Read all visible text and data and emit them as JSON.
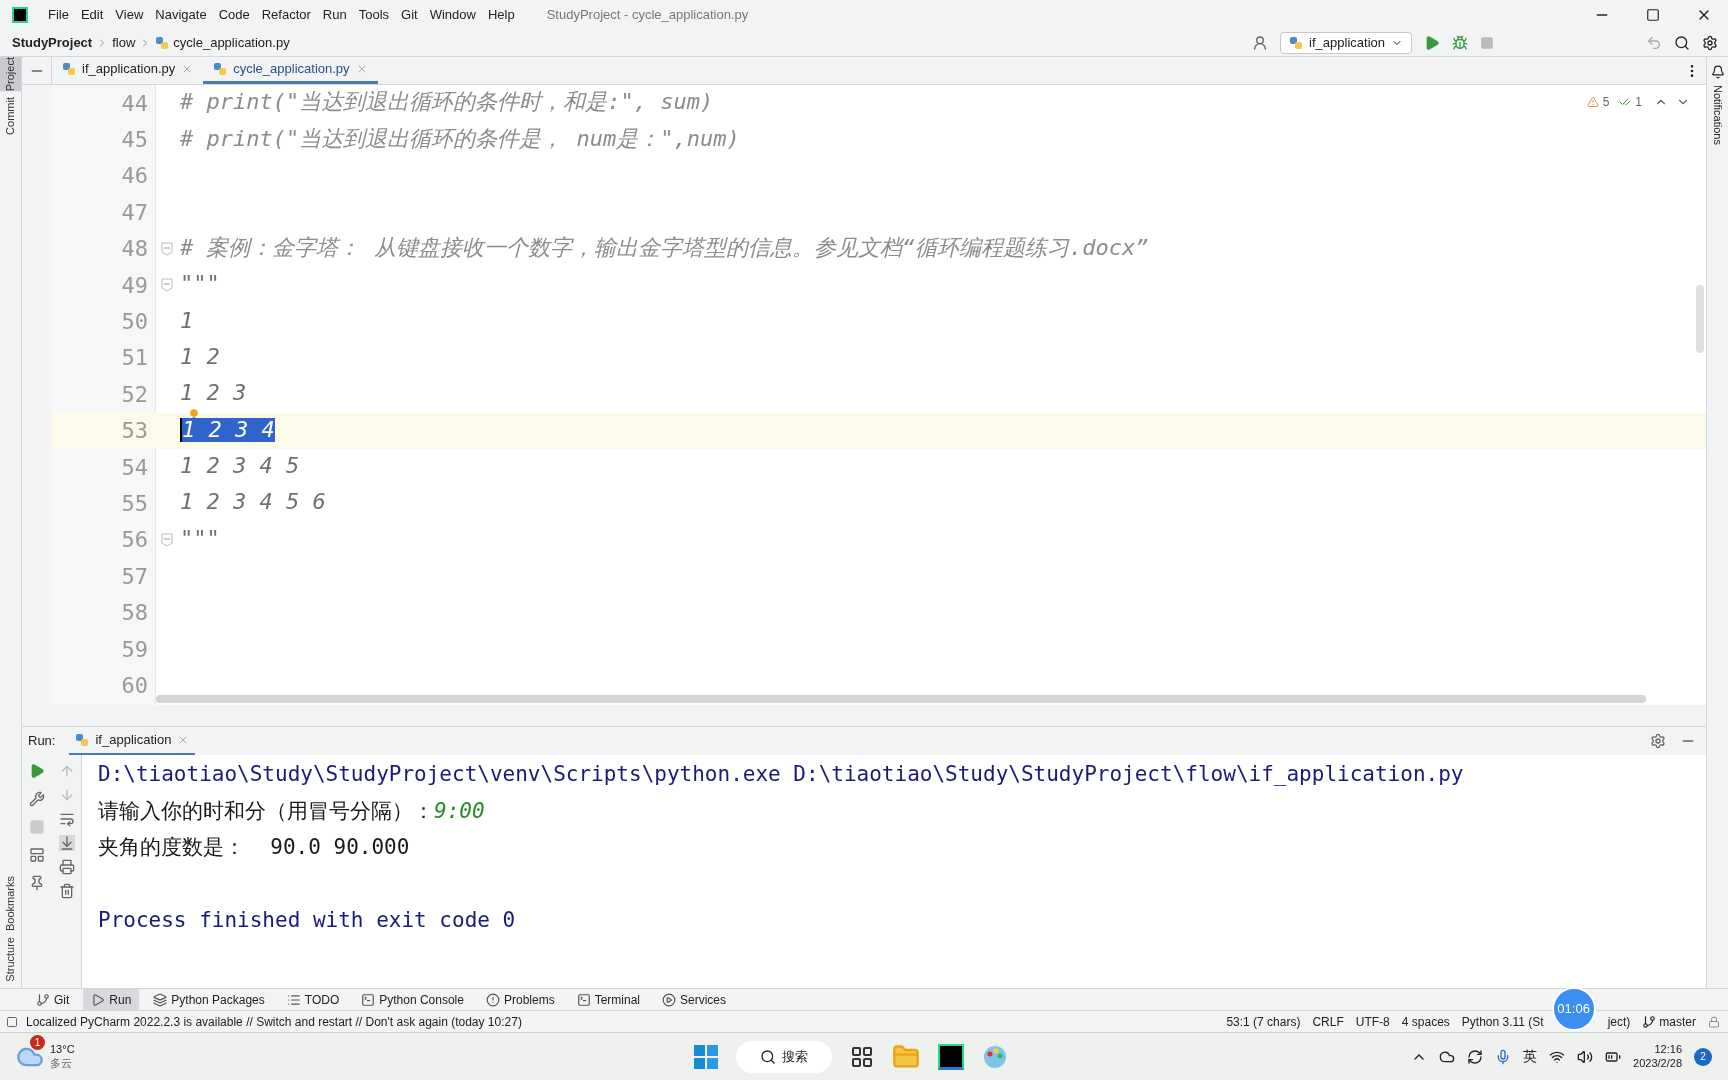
{
  "window": {
    "title": "StudyProject - cycle_application.py",
    "menu": [
      "File",
      "Edit",
      "View",
      "Navigate",
      "Code",
      "Refactor",
      "Run",
      "Tools",
      "Git",
      "Window",
      "Help"
    ]
  },
  "breadcrumb": [
    "StudyProject",
    "flow",
    "cycle_application.py"
  ],
  "run_config": "if_application",
  "side_tools_top": [
    {
      "label": "Project",
      "selected": true
    },
    {
      "label": "Commit",
      "selected": false
    }
  ],
  "side_tools_bottom": [
    {
      "label": "Bookmarks",
      "selected": false
    },
    {
      "label": "Structure",
      "selected": false
    }
  ],
  "right_tools": [
    "Notifications"
  ],
  "tabs": [
    {
      "label": "if_application.py",
      "selected": false
    },
    {
      "label": "cycle_application.py",
      "selected": true
    }
  ],
  "inspections": {
    "warnings": "5",
    "passed": "1"
  },
  "lines": [
    {
      "number": "44",
      "text": "# print(\"当达到退出循环的条件时，和是:\", sum)",
      "kind": "comment",
      "current": false
    },
    {
      "number": "45",
      "text": "# print(\"当达到退出循环的条件是， num是：\",num)",
      "kind": "comment",
      "current": false
    },
    {
      "number": "46",
      "kind": "plain",
      "current": false
    },
    {
      "number": "47",
      "kind": "plain",
      "current": false
    },
    {
      "number": "48",
      "text": "# 案例：金字塔： 从键盘接收一个数字，输出金字塔型的信息。参见文档“循环编程题练习.docx”",
      "kind": "comment",
      "current": false,
      "fold": true
    },
    {
      "number": "49",
      "text": "\"\"\"",
      "kind": "docstring",
      "current": false,
      "fold": true
    },
    {
      "number": "50",
      "text": "1",
      "kind": "docstring",
      "current": false
    },
    {
      "number": "51",
      "text": "1 2",
      "kind": "docstring",
      "current": false
    },
    {
      "number": "52",
      "text": "1 2 3",
      "kind": "docstring",
      "current": false,
      "bulb": true
    },
    {
      "number": "53",
      "text": "1 2 3 4",
      "kind": "docstring",
      "current": true,
      "selection": true
    },
    {
      "number": "54",
      "text": "1 2 3 4 5",
      "kind": "docstring",
      "current": false
    },
    {
      "number": "55",
      "text": "1 2 3 4 5 6",
      "kind": "docstring",
      "current": false
    },
    {
      "number": "56",
      "text": "\"\"\"",
      "kind": "docstring",
      "current": false,
      "fold": true
    },
    {
      "number": "57",
      "kind": "plain",
      "current": false
    },
    {
      "number": "58",
      "kind": "plain",
      "current": false
    },
    {
      "number": "59",
      "kind": "plain",
      "current": false
    },
    {
      "number": "60",
      "kind": "plain",
      "current": false
    }
  ],
  "run": {
    "label": "Run:",
    "tab": "if_application",
    "console": [
      {
        "kind": "command",
        "text": "D:\\tiaotiao\\Study\\StudyProject\\venv\\Scripts\\python.exe D:\\tiaotiao\\Study\\StudyProject\\flow\\if_application.py"
      },
      {
        "kind": "prompt",
        "text": "请输入你的时和分（用冒号分隔）：",
        "input": "9:00"
      },
      {
        "kind": "output",
        "text": "夹角的度数是：  90.0 90.000"
      },
      {
        "kind": "blank"
      },
      {
        "kind": "command",
        "text": "Process finished with exit code 0"
      }
    ]
  },
  "tool_windows": [
    {
      "label": "Git",
      "selected": false
    },
    {
      "label": "Run",
      "selected": true
    },
    {
      "label": "Python Packages",
      "selected": false
    },
    {
      "label": "TODO",
      "selected": false
    },
    {
      "label": "Python Console",
      "selected": false
    },
    {
      "label": "Problems",
      "selected": false
    },
    {
      "label": "Terminal",
      "selected": false
    },
    {
      "label": "Services",
      "selected": false
    }
  ],
  "status_bar": {
    "message": "Localized PyCharm 2022.2.3 is available // Switch and restart // Don't ask again (today 10:27)",
    "position": "53:1 (7 chars)",
    "line_ending": "CRLF",
    "encoding": "UTF-8",
    "indent": "4 spaces",
    "interpreter_start": "Python 3.11 (St",
    "interpreter_end": "ject)",
    "branch": "master",
    "timer": "01:06"
  },
  "taskbar": {
    "temperature": "13°C",
    "weather": "多云",
    "weather_badge": "1",
    "search": "搜索",
    "ime": "英",
    "time": "12:16",
    "date": "2023/2/28",
    "notifications": "2"
  }
}
